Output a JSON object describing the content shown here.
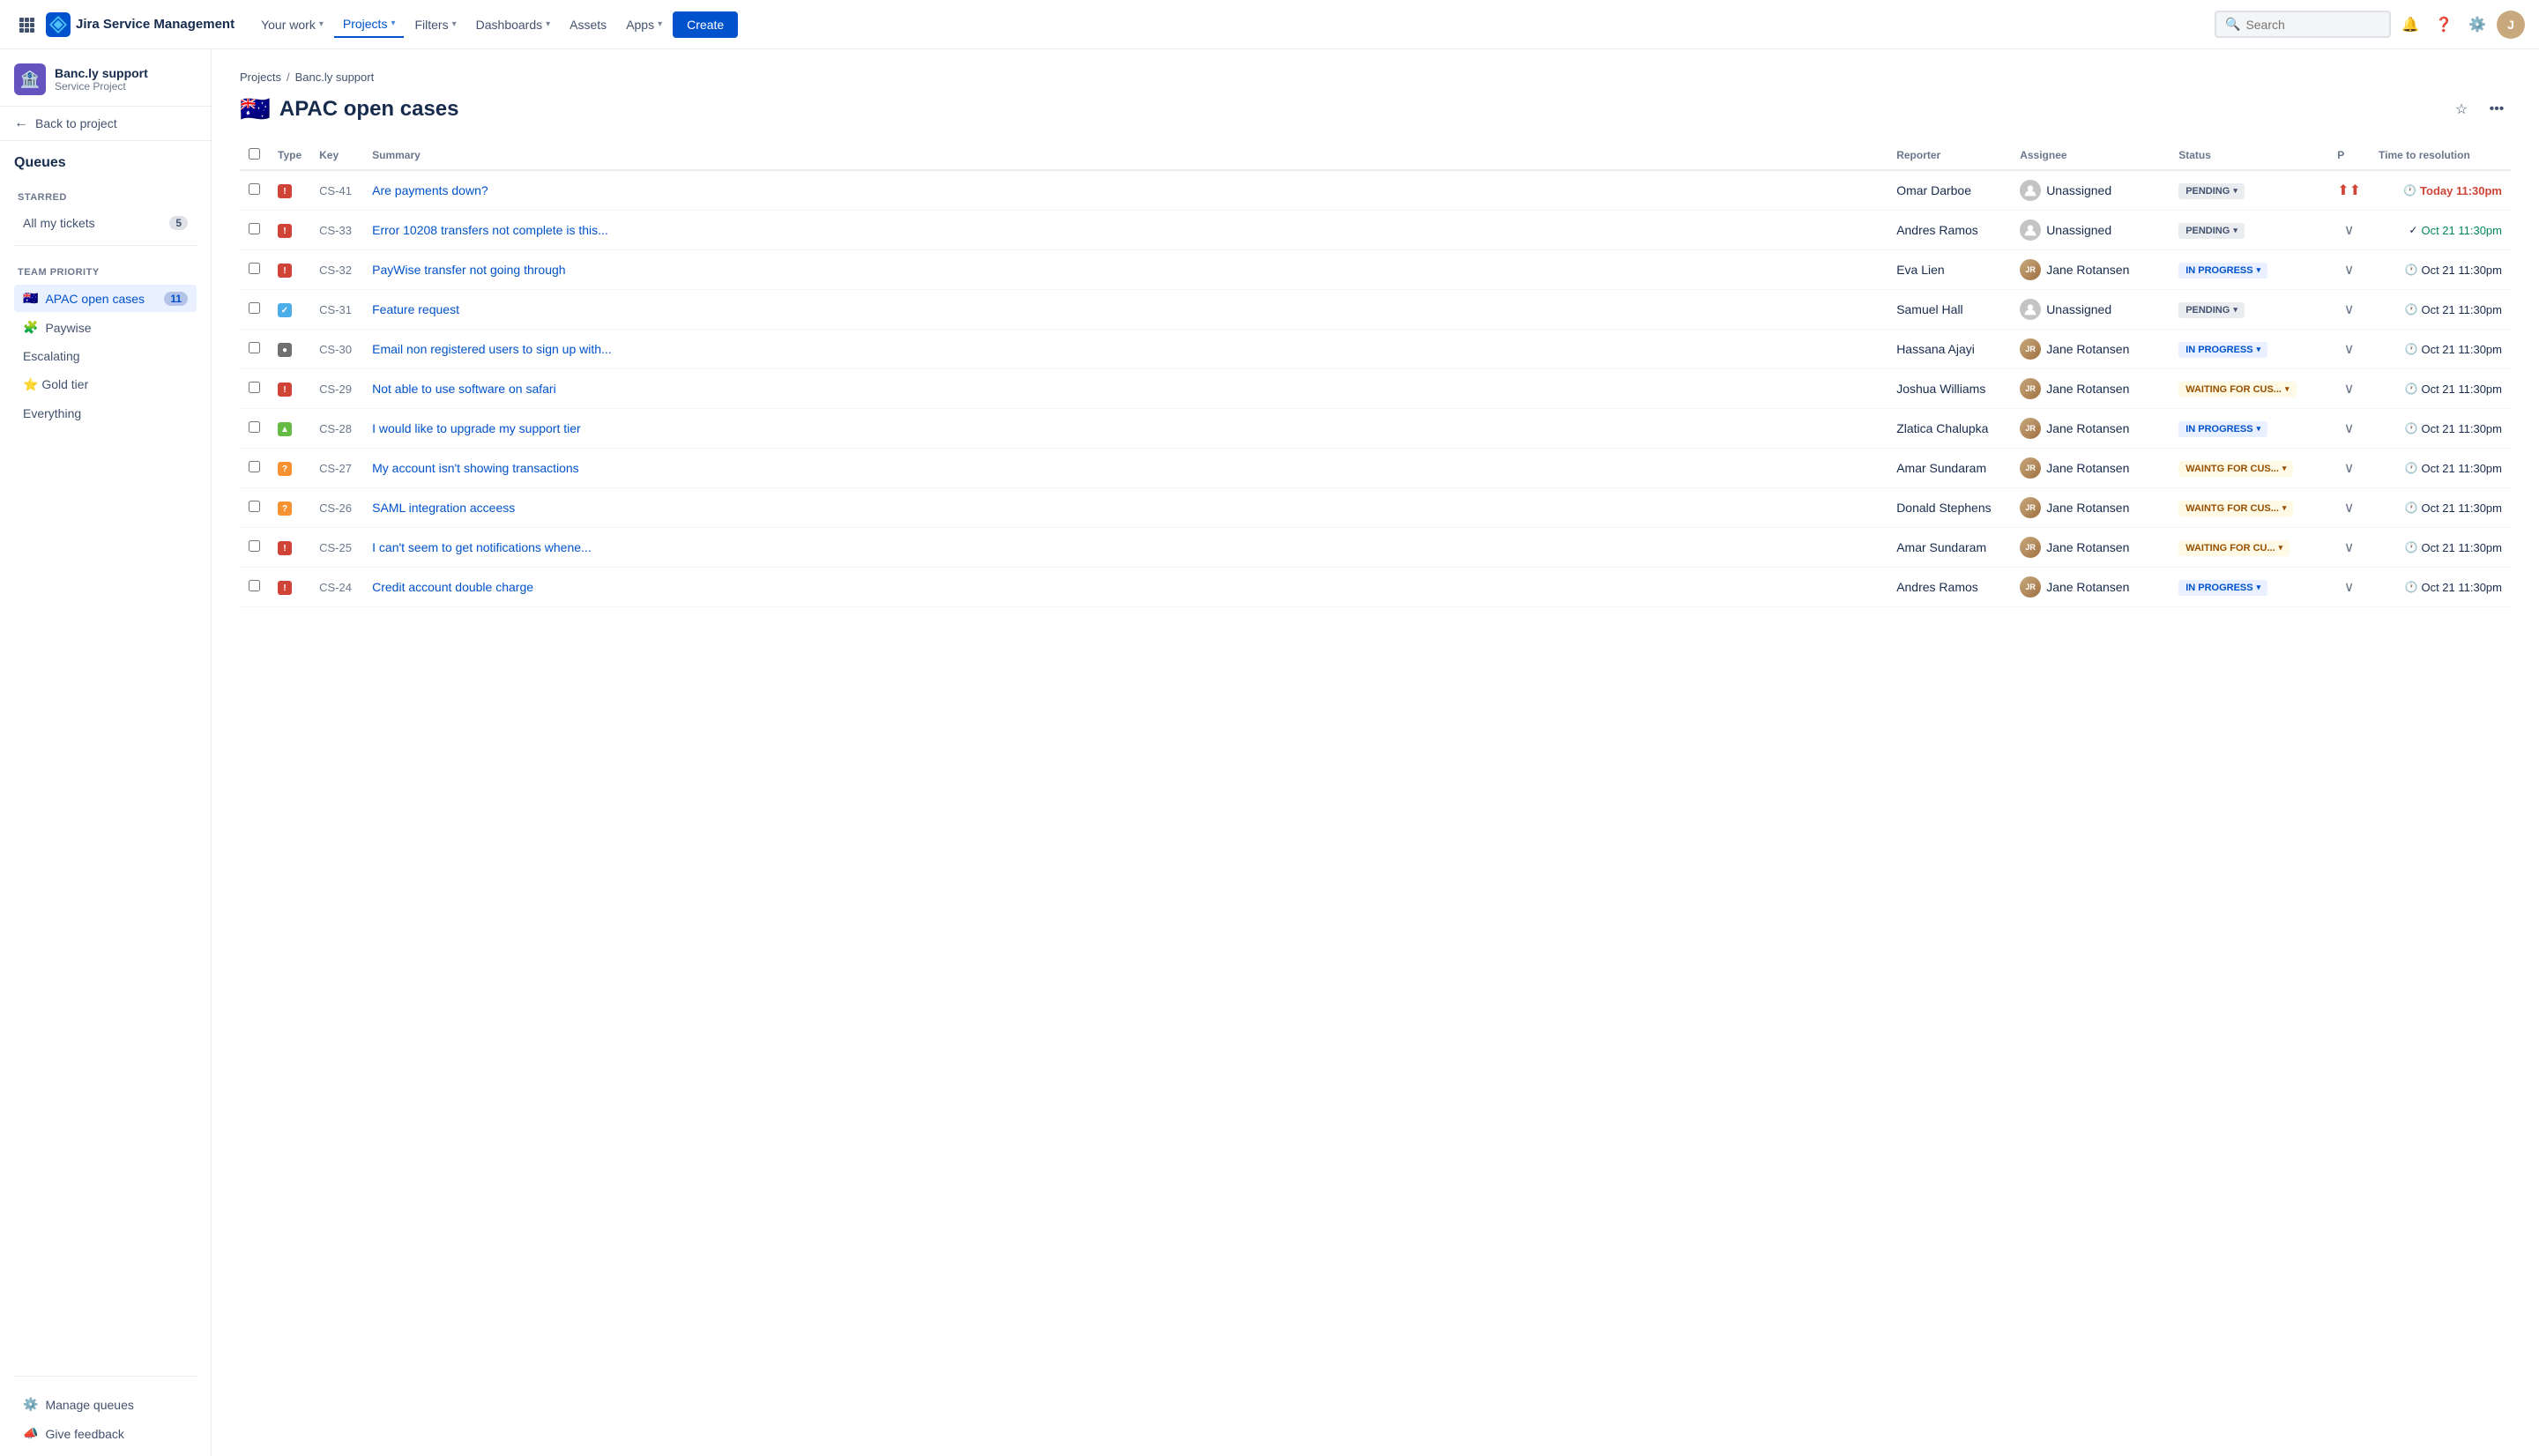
{
  "brand": {
    "icon": "⚡",
    "name": "Jira Service Management"
  },
  "nav": {
    "links": [
      {
        "label": "Your work",
        "dropdown": true,
        "active": false
      },
      {
        "label": "Projects",
        "dropdown": true,
        "active": true
      },
      {
        "label": "Filters",
        "dropdown": true,
        "active": false
      },
      {
        "label": "Dashboards",
        "dropdown": true,
        "active": false
      },
      {
        "label": "Assets",
        "dropdown": false,
        "active": false
      },
      {
        "label": "Apps",
        "dropdown": true,
        "active": false
      }
    ],
    "create_label": "Create",
    "search_placeholder": "Search"
  },
  "sidebar": {
    "project_name": "Banc.ly support",
    "project_type": "Service Project",
    "back_label": "Back to project",
    "queues_label": "Queues",
    "starred_label": "STARRED",
    "team_priority_label": "TEAM PRIORITY",
    "all_tickets_label": "All my tickets",
    "all_tickets_count": "5",
    "apac_label": "APAC open cases",
    "apac_count": "11",
    "paywise_label": "Paywise",
    "escalating_label": "Escalating",
    "gold_tier_label": "⭐ Gold tier",
    "everything_label": "Everything",
    "manage_queues_label": "Manage queues",
    "give_feedback_label": "Give feedback"
  },
  "page": {
    "breadcrumb_projects": "Projects",
    "breadcrumb_project": "Banc.ly support",
    "title_emoji": "🇦🇺",
    "title": "APAC open cases"
  },
  "table": {
    "columns": [
      "",
      "Type",
      "Key",
      "Summary",
      "Reporter",
      "Assignee",
      "Status",
      "P",
      "Time to resolution"
    ],
    "rows": [
      {
        "key": "CS-41",
        "type": "bug",
        "summary": "Are payments down?",
        "reporter": "Omar Darboe",
        "assignee": "Unassigned",
        "assignee_type": "unassigned",
        "status": "PENDING",
        "status_type": "pending",
        "priority": "high",
        "time": "Today 11:30pm",
        "time_type": "overdue",
        "time_icon": "clock"
      },
      {
        "key": "CS-33",
        "type": "bug",
        "summary": "Error 10208 transfers not complete is this...",
        "reporter": "Andres Ramos",
        "assignee": "Unassigned",
        "assignee_type": "unassigned",
        "status": "PENDING",
        "status_type": "pending",
        "priority": "normal",
        "time": "Oct 21 11:30pm",
        "time_type": "done",
        "time_icon": "check"
      },
      {
        "key": "CS-32",
        "type": "bug",
        "summary": "PayWise transfer not going through",
        "reporter": "Eva Lien",
        "assignee": "Jane Rotansen",
        "assignee_type": "person",
        "status": "IN PROGRESS",
        "status_type": "inprogress",
        "priority": "normal",
        "time": "Oct 21 11:30pm",
        "time_type": "normal",
        "time_icon": "clock"
      },
      {
        "key": "CS-31",
        "type": "task",
        "summary": "Feature request",
        "reporter": "Samuel Hall",
        "assignee": "Unassigned",
        "assignee_type": "unassigned",
        "status": "PENDING",
        "status_type": "pending",
        "priority": "normal",
        "time": "Oct 21 11:30pm",
        "time_type": "normal",
        "time_icon": "clock"
      },
      {
        "key": "CS-30",
        "type": "blocked",
        "summary": "Email non registered users to sign up with...",
        "reporter": "Hassana Ajayi",
        "assignee": "Jane Rotansen",
        "assignee_type": "person",
        "status": "IN PROGRESS",
        "status_type": "inprogress",
        "priority": "normal",
        "time": "Oct 21 11:30pm",
        "time_type": "normal",
        "time_icon": "clock"
      },
      {
        "key": "CS-29",
        "type": "bug",
        "summary": "Not able to use software on safari",
        "reporter": "Joshua Williams",
        "assignee": "Jane Rotansen",
        "assignee_type": "person",
        "status": "WAITING FOR CUS...",
        "status_type": "waiting",
        "priority": "normal",
        "time": "Oct 21 11:30pm",
        "time_type": "normal",
        "time_icon": "clock"
      },
      {
        "key": "CS-28",
        "type": "story",
        "summary": "I would like to upgrade my support tier",
        "reporter": "Zlatica Chalupka",
        "assignee": "Jane Rotansen",
        "assignee_type": "person",
        "status": "IN PROGRESS",
        "status_type": "inprogress",
        "priority": "normal",
        "time": "Oct 21 11:30pm",
        "time_type": "normal",
        "time_icon": "clock"
      },
      {
        "key": "CS-27",
        "type": "question",
        "summary": "My account isn't showing transactions",
        "reporter": "Amar Sundaram",
        "assignee": "Jane Rotansen",
        "assignee_type": "person",
        "status": "WAINTG FOR CUS...",
        "status_type": "waiting",
        "priority": "normal",
        "time": "Oct 21 11:30pm",
        "time_type": "normal",
        "time_icon": "clock"
      },
      {
        "key": "CS-26",
        "type": "question",
        "summary": "SAML integration acceess",
        "reporter": "Donald Stephens",
        "assignee": "Jane Rotansen",
        "assignee_type": "person",
        "status": "WAINTG FOR CUS...",
        "status_type": "waiting",
        "priority": "normal",
        "time": "Oct 21 11:30pm",
        "time_type": "normal",
        "time_icon": "clock"
      },
      {
        "key": "CS-25",
        "type": "bug",
        "summary": "I can't seem to get notifications whene...",
        "reporter": "Amar Sundaram",
        "assignee": "Jane Rotansen",
        "assignee_type": "person",
        "status": "WAITING FOR CU...",
        "status_type": "waiting",
        "priority": "normal",
        "time": "Oct 21 11:30pm",
        "time_type": "normal",
        "time_icon": "clock"
      },
      {
        "key": "CS-24",
        "type": "bug",
        "summary": "Credit account double charge",
        "reporter": "Andres Ramos",
        "assignee": "Jane Rotansen",
        "assignee_type": "person",
        "status": "IN PROGRESS",
        "status_type": "inprogress",
        "priority": "normal",
        "time": "Oct 21 11:30pm",
        "time_type": "normal",
        "time_icon": "clock"
      }
    ]
  }
}
